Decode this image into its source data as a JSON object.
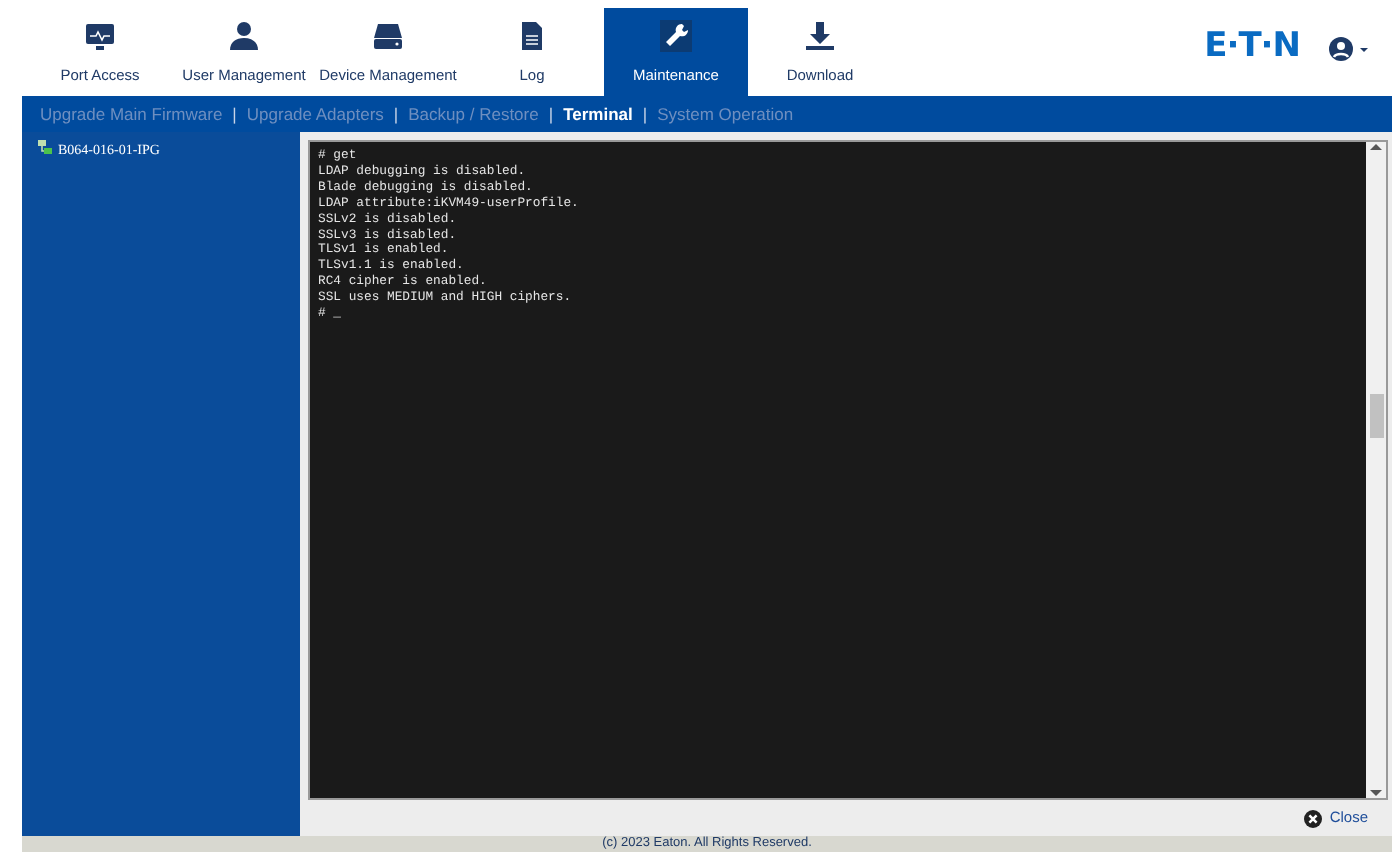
{
  "tabs": [
    {
      "label": "Port Access",
      "kind": "monitor",
      "selected": false
    },
    {
      "label": "User Management",
      "kind": "person",
      "selected": false
    },
    {
      "label": "Device Management",
      "kind": "drive",
      "selected": false
    },
    {
      "label": "Log",
      "kind": "document",
      "selected": false
    },
    {
      "label": "Maintenance",
      "kind": "wrench",
      "selected": true
    },
    {
      "label": "Download",
      "kind": "download",
      "selected": false
    }
  ],
  "logo": "E·T·N",
  "subnav": [
    {
      "label": "Upgrade Main Firmware",
      "selected": false
    },
    {
      "label": "Upgrade Adapters",
      "selected": false
    },
    {
      "label": "Backup / Restore",
      "selected": false
    },
    {
      "label": "Terminal",
      "selected": true
    },
    {
      "label": "System Operation",
      "selected": false
    }
  ],
  "subnav_separator": "|",
  "sidebar": {
    "items": [
      {
        "label": "B064-016-01-IPG"
      }
    ]
  },
  "terminal": {
    "lines": [
      "# get",
      "LDAP debugging is disabled.",
      "Blade debugging is disabled.",
      "LDAP attribute:iKVM49-userProfile.",
      "SSLv2 is disabled.",
      "SSLv3 is disabled.",
      "TLSv1 is enabled.",
      "TLSv1.1 is enabled.",
      "RC4 cipher is enabled.",
      "SSL uses MEDIUM and HIGH ciphers.",
      "# _"
    ]
  },
  "close_button": "Close",
  "footer": "(c) 2023 Eaton. All Rights Reserved."
}
